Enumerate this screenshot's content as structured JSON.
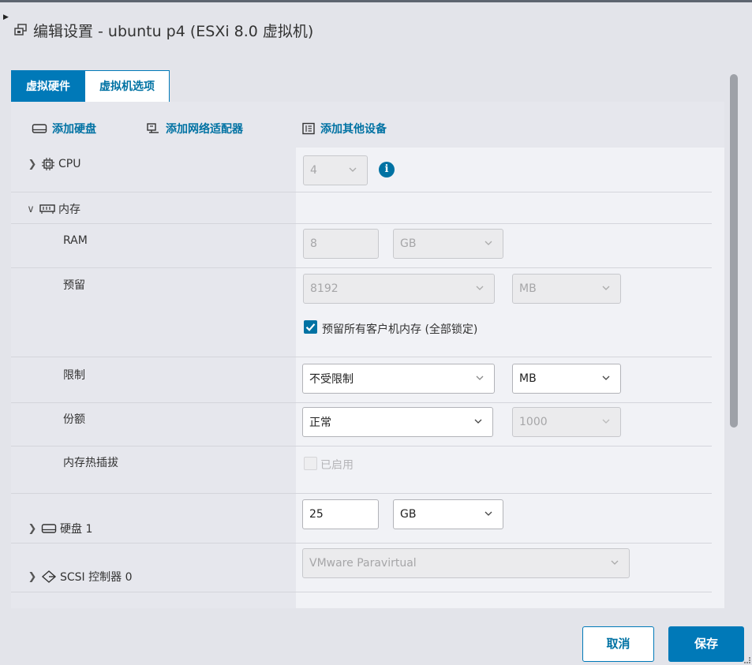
{
  "dialog": {
    "title": "编辑设置 - ubuntu p4 (ESXi 8.0 虚拟机)"
  },
  "tabs": [
    {
      "label": "虚拟硬件",
      "active": true
    },
    {
      "label": "虚拟机选项",
      "active": false
    }
  ],
  "toolbar": {
    "add_disk": "添加硬盘",
    "add_network": "添加网络适配器",
    "add_other": "添加其他设备"
  },
  "hardware": {
    "cpu": {
      "label": "CPU",
      "value": "4"
    },
    "memory": {
      "label": "内存",
      "ram": {
        "label": "RAM",
        "value": "8",
        "unit": "GB"
      },
      "reservation": {
        "label": "预留",
        "value": "8192",
        "unit": "MB",
        "lock_all_label": "预留所有客户机内存 (全部锁定)",
        "lock_all_checked": true
      },
      "limit": {
        "label": "限制",
        "value": "不受限制",
        "unit": "MB"
      },
      "shares": {
        "label": "份额",
        "value": "正常",
        "amount": "1000"
      },
      "hotplug": {
        "label": "内存热插拔",
        "checkbox_label": "已启用",
        "enabled": false
      }
    },
    "disk1": {
      "label": "硬盘 1",
      "size": "25",
      "unit": "GB"
    },
    "scsi0": {
      "label": "SCSI 控制器 0",
      "value": "VMware Paravirtual"
    }
  },
  "buttons": {
    "cancel": "取消",
    "save": "保存"
  },
  "colors": {
    "accent": "#0079b8",
    "link": "#0072a3"
  }
}
